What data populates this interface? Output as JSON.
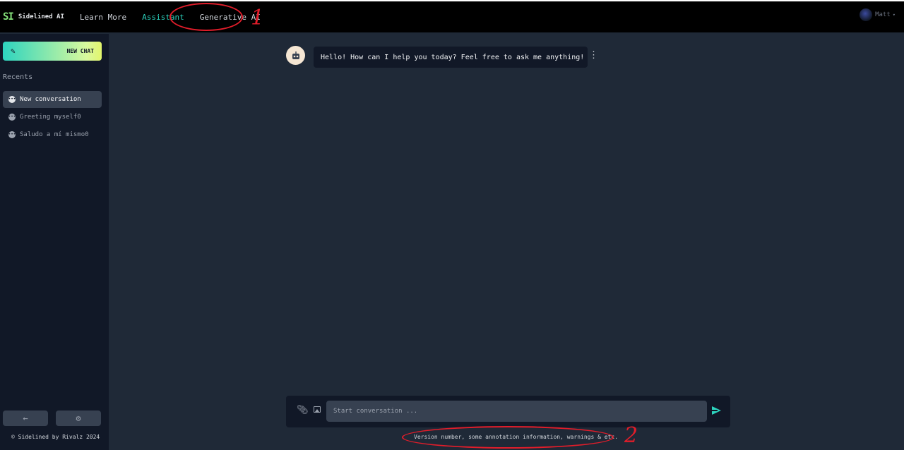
{
  "header": {
    "logo_mark": "SI",
    "logo_text": "Sidelined AI",
    "nav": [
      {
        "label": "Learn More",
        "active": false
      },
      {
        "label": "Assistant",
        "active": true
      },
      {
        "label": "Generative AI",
        "active": false
      }
    ],
    "user": {
      "name": "Matt"
    }
  },
  "annotations": {
    "one": "1",
    "two": "2"
  },
  "sidebar": {
    "new_chat_label": "NEW CHAT",
    "recents_label": "Recents",
    "conversations": [
      {
        "label": "New conversation",
        "active": true
      },
      {
        "label": "Greeting myself0",
        "active": false
      },
      {
        "label": "Saludo a mí mismo0",
        "active": false
      }
    ],
    "copyright": "© Sidelined by Rivalz 2024"
  },
  "chat": {
    "greeting": "Hello! How can I help you today? Feel free to ask me anything!"
  },
  "composer": {
    "placeholder": "Start conversation ..."
  },
  "footer": {
    "note": "Version number, some annotation information, warnings & etc."
  },
  "colors": {
    "accent": "#2dd4bf",
    "annotation": "#e11d2a",
    "sidebar_bg": "#111827",
    "main_bg": "#1f2937"
  }
}
